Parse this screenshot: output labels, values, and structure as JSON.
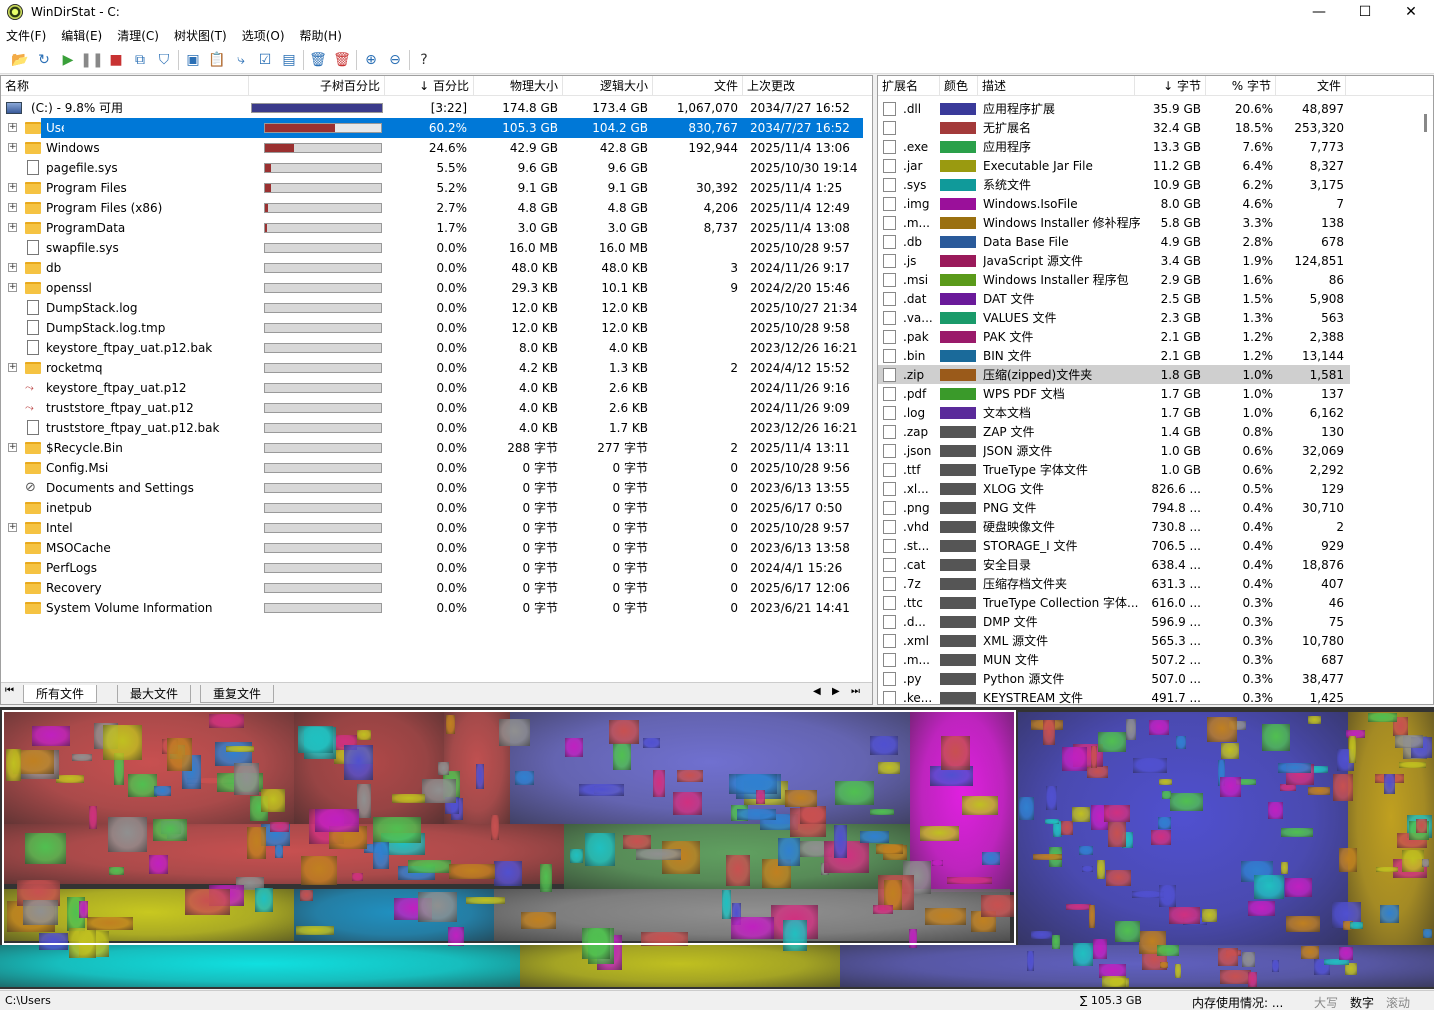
{
  "window": {
    "title": "WinDirStat - C:",
    "minimize": "—",
    "maximize": "☐",
    "close": "✕"
  },
  "menu": [
    "文件(F)",
    "编辑(E)",
    "清理(C)",
    "树状图(T)",
    "选项(O)",
    "帮助(H)"
  ],
  "toolbar": [
    {
      "icon": "open-folder-icon",
      "glyph": "📂"
    },
    {
      "icon": "refresh-icon",
      "glyph": "↻"
    },
    {
      "icon": "play-icon",
      "glyph": "▶"
    },
    {
      "icon": "pause-icon",
      "glyph": "❚❚"
    },
    {
      "icon": "stop-icon",
      "glyph": "■"
    },
    {
      "icon": "copy-path-icon",
      "glyph": "⧉"
    },
    {
      "icon": "filter-icon",
      "glyph": "⛉"
    },
    {
      "icon": "explorer-icon",
      "glyph": "▣"
    },
    {
      "icon": "clipboard-icon",
      "glyph": "📋"
    },
    {
      "icon": "select-icon",
      "glyph": "⤷"
    },
    {
      "icon": "properties-icon",
      "glyph": "☑"
    },
    {
      "icon": "command-prompt-icon",
      "glyph": "▤"
    },
    {
      "icon": "recycle-icon",
      "glyph": "🗑"
    },
    {
      "icon": "delete-icon",
      "glyph": "🗑"
    },
    {
      "icon": "zoom-in-icon",
      "glyph": "⊕"
    },
    {
      "icon": "zoom-out-icon",
      "glyph": "⊖"
    },
    {
      "icon": "help-icon",
      "glyph": "?"
    }
  ],
  "tree": {
    "columns": [
      "名称",
      "子树百分比",
      "↓ 百分比",
      "物理大小",
      "逻辑大小",
      "文件",
      "上次更改"
    ],
    "root": {
      "name": "(C:) - 9.8% 可用",
      "percent": "[3:22]",
      "phys": "174.8 GB",
      "logical": "173.4 GB",
      "files": "1,067,070",
      "modified": "2034/7/27  16:52",
      "fill": 100
    },
    "rows": [
      {
        "name": "Users",
        "type": "folder",
        "exp": true,
        "fill": 60.2,
        "pct": "60.2%",
        "phys": "105.3 GB",
        "logical": "104.2 GB",
        "files": "830,767",
        "mod": "2034/7/27  16:52",
        "selected": true
      },
      {
        "name": "Windows",
        "type": "folder",
        "exp": true,
        "fill": 24.6,
        "pct": "24.6%",
        "phys": "42.9 GB",
        "logical": "42.8 GB",
        "files": "192,944",
        "mod": "2025/11/4  13:06"
      },
      {
        "name": "pagefile.sys",
        "type": "file",
        "exp": false,
        "fill": 5.5,
        "pct": "5.5%",
        "phys": "9.6 GB",
        "logical": "9.6 GB",
        "files": "",
        "mod": "2025/10/30  19:14"
      },
      {
        "name": "Program Files",
        "type": "folder",
        "exp": true,
        "fill": 5.2,
        "pct": "5.2%",
        "phys": "9.1 GB",
        "logical": "9.1 GB",
        "files": "30,392",
        "mod": "2025/11/4  1:25"
      },
      {
        "name": "Program Files (x86)",
        "type": "folder",
        "exp": true,
        "fill": 2.7,
        "pct": "2.7%",
        "phys": "4.8 GB",
        "logical": "4.8 GB",
        "files": "4,206",
        "mod": "2025/11/4  12:49"
      },
      {
        "name": "ProgramData",
        "type": "folder",
        "exp": true,
        "fill": 1.7,
        "pct": "1.7%",
        "phys": "3.0 GB",
        "logical": "3.0 GB",
        "files": "8,737",
        "mod": "2025/11/4  13:08"
      },
      {
        "name": "swapfile.sys",
        "type": "file",
        "exp": false,
        "fill": 0,
        "pct": "0.0%",
        "phys": "16.0 MB",
        "logical": "16.0 MB",
        "files": "",
        "mod": "2025/10/28  9:57"
      },
      {
        "name": "db",
        "type": "folder",
        "exp": true,
        "fill": 0,
        "pct": "0.0%",
        "phys": "48.0 KB",
        "logical": "48.0 KB",
        "files": "3",
        "mod": "2024/11/26  9:17"
      },
      {
        "name": "openssl",
        "type": "folder",
        "exp": true,
        "fill": 0,
        "pct": "0.0%",
        "phys": "29.3 KB",
        "logical": "10.1 KB",
        "files": "9",
        "mod": "2024/2/20  15:46"
      },
      {
        "name": "DumpStack.log",
        "type": "file",
        "exp": false,
        "fill": 0,
        "pct": "0.0%",
        "phys": "12.0 KB",
        "logical": "12.0 KB",
        "files": "",
        "mod": "2025/10/27  21:34"
      },
      {
        "name": "DumpStack.log.tmp",
        "type": "file",
        "exp": false,
        "fill": 0,
        "pct": "0.0%",
        "phys": "12.0 KB",
        "logical": "12.0 KB",
        "files": "",
        "mod": "2025/10/28  9:58"
      },
      {
        "name": "keystore_ftpay_uat.p12.bak",
        "type": "file",
        "exp": false,
        "fill": 0,
        "pct": "0.0%",
        "phys": "8.0 KB",
        "logical": "4.0 KB",
        "files": "",
        "mod": "2023/12/26  16:21"
      },
      {
        "name": "rocketmq",
        "type": "folder",
        "exp": true,
        "fill": 0,
        "pct": "0.0%",
        "phys": "4.2 KB",
        "logical": "1.3 KB",
        "files": "2",
        "mod": "2024/4/12  15:52"
      },
      {
        "name": "keystore_ftpay_uat.p12",
        "type": "cert",
        "exp": false,
        "fill": 0,
        "pct": "0.0%",
        "phys": "4.0 KB",
        "logical": "2.6 KB",
        "files": "",
        "mod": "2024/11/26  9:16"
      },
      {
        "name": "truststore_ftpay_uat.p12",
        "type": "cert",
        "exp": false,
        "fill": 0,
        "pct": "0.0%",
        "phys": "4.0 KB",
        "logical": "2.6 KB",
        "files": "",
        "mod": "2024/11/26  9:09"
      },
      {
        "name": "truststore_ftpay_uat.p12.bak",
        "type": "file",
        "exp": false,
        "fill": 0,
        "pct": "0.0%",
        "phys": "4.0 KB",
        "logical": "1.7 KB",
        "files": "",
        "mod": "2023/12/26  16:21"
      },
      {
        "name": "$Recycle.Bin",
        "type": "folder",
        "exp": true,
        "fill": 0,
        "pct": "0.0%",
        "phys": "288 字节",
        "logical": "277 字节",
        "files": "2",
        "mod": "2025/11/4  13:11"
      },
      {
        "name": "Config.Msi",
        "type": "folder",
        "exp": false,
        "fill": 0,
        "pct": "0.0%",
        "phys": "0 字节",
        "logical": "0 字节",
        "files": "0",
        "mod": "2025/10/28  9:56"
      },
      {
        "name": "Documents and Settings",
        "type": "link",
        "exp": false,
        "fill": 0,
        "pct": "0.0%",
        "phys": "0 字节",
        "logical": "0 字节",
        "files": "0",
        "mod": "2023/6/13  13:55"
      },
      {
        "name": "inetpub",
        "type": "folder",
        "exp": false,
        "fill": 0,
        "pct": "0.0%",
        "phys": "0 字节",
        "logical": "0 字节",
        "files": "0",
        "mod": "2025/6/17  0:50"
      },
      {
        "name": "Intel",
        "type": "folder",
        "exp": true,
        "fill": 0,
        "pct": "0.0%",
        "phys": "0 字节",
        "logical": "0 字节",
        "files": "0",
        "mod": "2025/10/28  9:57"
      },
      {
        "name": "MSOCache",
        "type": "folder",
        "exp": false,
        "fill": 0,
        "pct": "0.0%",
        "phys": "0 字节",
        "logical": "0 字节",
        "files": "0",
        "mod": "2023/6/13  13:58"
      },
      {
        "name": "PerfLogs",
        "type": "folder",
        "exp": false,
        "fill": 0,
        "pct": "0.0%",
        "phys": "0 字节",
        "logical": "0 字节",
        "files": "0",
        "mod": "2024/4/1  15:26"
      },
      {
        "name": "Recovery",
        "type": "folder",
        "exp": false,
        "fill": 0,
        "pct": "0.0%",
        "phys": "0 字节",
        "logical": "0 字节",
        "files": "0",
        "mod": "2025/6/17  12:06"
      },
      {
        "name": "System Volume Information",
        "type": "folder",
        "exp": false,
        "fill": 0,
        "pct": "0.0%",
        "phys": "0 字节",
        "logical": "0 字节",
        "files": "0",
        "mod": "2023/6/21  14:41"
      }
    ],
    "tabs": [
      "所有文件",
      "最大文件",
      "重复文件"
    ]
  },
  "extensions": {
    "columns": [
      "扩展名",
      "颜色",
      "描述",
      "↓ 字节",
      "% 字节",
      "文件"
    ],
    "rows": [
      {
        "ext": ".dll",
        "color": "#3a3a9a",
        "desc": "应用程序扩展",
        "bytes": "35.9 GB",
        "pct": "20.6%",
        "files": "48,897"
      },
      {
        "ext": "",
        "color": "#a33a3a",
        "desc": "无扩展名",
        "bytes": "32.4 GB",
        "pct": "18.5%",
        "files": "253,320"
      },
      {
        "ext": ".exe",
        "color": "#2aa04a",
        "desc": "应用程序",
        "bytes": "13.3 GB",
        "pct": "7.6%",
        "files": "7,773"
      },
      {
        "ext": ".jar",
        "color": "#9a9a10",
        "desc": "Executable Jar File",
        "bytes": "11.2 GB",
        "pct": "6.4%",
        "files": "8,327"
      },
      {
        "ext": ".sys",
        "color": "#109a9a",
        "desc": "系统文件",
        "bytes": "10.9 GB",
        "pct": "6.2%",
        "files": "3,175"
      },
      {
        "ext": ".img",
        "color": "#9a109a",
        "desc": "Windows.IsoFile",
        "bytes": "8.0 GB",
        "pct": "4.6%",
        "files": "7"
      },
      {
        "ext": ".m...",
        "color": "#9a7010",
        "desc": "Windows Installer 修补程序",
        "bytes": "5.8 GB",
        "pct": "3.3%",
        "files": "138"
      },
      {
        "ext": ".db",
        "color": "#2a5a9a",
        "desc": "Data Base File",
        "bytes": "4.9 GB",
        "pct": "2.8%",
        "files": "678"
      },
      {
        "ext": ".js",
        "color": "#9a1a5a",
        "desc": "JavaScript 源文件",
        "bytes": "3.4 GB",
        "pct": "1.9%",
        "files": "124,851"
      },
      {
        "ext": ".msi",
        "color": "#5a9a1a",
        "desc": "Windows Installer 程序包",
        "bytes": "2.9 GB",
        "pct": "1.6%",
        "files": "86"
      },
      {
        "ext": ".dat",
        "color": "#6a1a9a",
        "desc": "DAT 文件",
        "bytes": "2.5 GB",
        "pct": "1.5%",
        "files": "5,908"
      },
      {
        "ext": ".va...",
        "color": "#1a9a6a",
        "desc": "VALUES 文件",
        "bytes": "2.3 GB",
        "pct": "1.3%",
        "files": "563"
      },
      {
        "ext": ".pak",
        "color": "#9a1a6a",
        "desc": "PAK 文件",
        "bytes": "2.1 GB",
        "pct": "1.2%",
        "files": "2,388"
      },
      {
        "ext": ".bin",
        "color": "#1a6a9a",
        "desc": "BIN 文件",
        "bytes": "2.1 GB",
        "pct": "1.2%",
        "files": "13,144"
      },
      {
        "ext": ".zip",
        "color": "#9a5a1a",
        "desc": "压缩(zipped)文件夹",
        "bytes": "1.8 GB",
        "pct": "1.0%",
        "files": "1,581",
        "selected": true
      },
      {
        "ext": ".pdf",
        "color": "#3a9a2a",
        "desc": "WPS PDF 文档",
        "bytes": "1.7 GB",
        "pct": "1.0%",
        "files": "137"
      },
      {
        "ext": ".log",
        "color": "#5a2a9a",
        "desc": "文本文档",
        "bytes": "1.7 GB",
        "pct": "1.0%",
        "files": "6,162"
      },
      {
        "ext": ".zap",
        "color": "#555555",
        "desc": "ZAP 文件",
        "bytes": "1.4 GB",
        "pct": "0.8%",
        "files": "130"
      },
      {
        "ext": ".json",
        "color": "#555555",
        "desc": "JSON 源文件",
        "bytes": "1.0 GB",
        "pct": "0.6%",
        "files": "32,069"
      },
      {
        "ext": ".ttf",
        "color": "#555555",
        "desc": "TrueType 字体文件",
        "bytes": "1.0 GB",
        "pct": "0.6%",
        "files": "2,292"
      },
      {
        "ext": ".xl...",
        "color": "#555555",
        "desc": "XLOG 文件",
        "bytes": "826.6 ...",
        "pct": "0.5%",
        "files": "129"
      },
      {
        "ext": ".png",
        "color": "#555555",
        "desc": "PNG 文件",
        "bytes": "794.8 ...",
        "pct": "0.4%",
        "files": "30,710"
      },
      {
        "ext": ".vhd",
        "color": "#555555",
        "desc": "硬盘映像文件",
        "bytes": "730.8 ...",
        "pct": "0.4%",
        "files": "2"
      },
      {
        "ext": ".st...",
        "color": "#555555",
        "desc": "STORAGE_I 文件",
        "bytes": "706.5 ...",
        "pct": "0.4%",
        "files": "929"
      },
      {
        "ext": ".cat",
        "color": "#555555",
        "desc": "安全目录",
        "bytes": "638.4 ...",
        "pct": "0.4%",
        "files": "18,876"
      },
      {
        "ext": ".7z",
        "color": "#555555",
        "desc": "压缩存档文件夹",
        "bytes": "631.3 ...",
        "pct": "0.4%",
        "files": "407"
      },
      {
        "ext": ".ttc",
        "color": "#555555",
        "desc": "TrueType Collection 字体...",
        "bytes": "616.0 ...",
        "pct": "0.3%",
        "files": "46"
      },
      {
        "ext": ".d...",
        "color": "#555555",
        "desc": "DMP 文件",
        "bytes": "596.9 ...",
        "pct": "0.3%",
        "files": "75"
      },
      {
        "ext": ".xml",
        "color": "#555555",
        "desc": "XML 源文件",
        "bytes": "565.3 ...",
        "pct": "0.3%",
        "files": "10,780"
      },
      {
        "ext": ".m...",
        "color": "#555555",
        "desc": "MUN 文件",
        "bytes": "507.2 ...",
        "pct": "0.3%",
        "files": "687"
      },
      {
        "ext": ".py",
        "color": "#555555",
        "desc": "Python 源文件",
        "bytes": "507.0 ...",
        "pct": "0.3%",
        "files": "38,477"
      },
      {
        "ext": ".ke...",
        "color": "#555555",
        "desc": "KEYSTREAM 文件",
        "bytes": "491.7 ...",
        "pct": "0.3%",
        "files": "1,425"
      }
    ]
  },
  "status": {
    "path": "C:\\Users",
    "sum": "∑ 105.3 GB",
    "memory": "内存使用情况: ...",
    "caps": "大写",
    "num": "数字",
    "scroll": "滚动"
  }
}
